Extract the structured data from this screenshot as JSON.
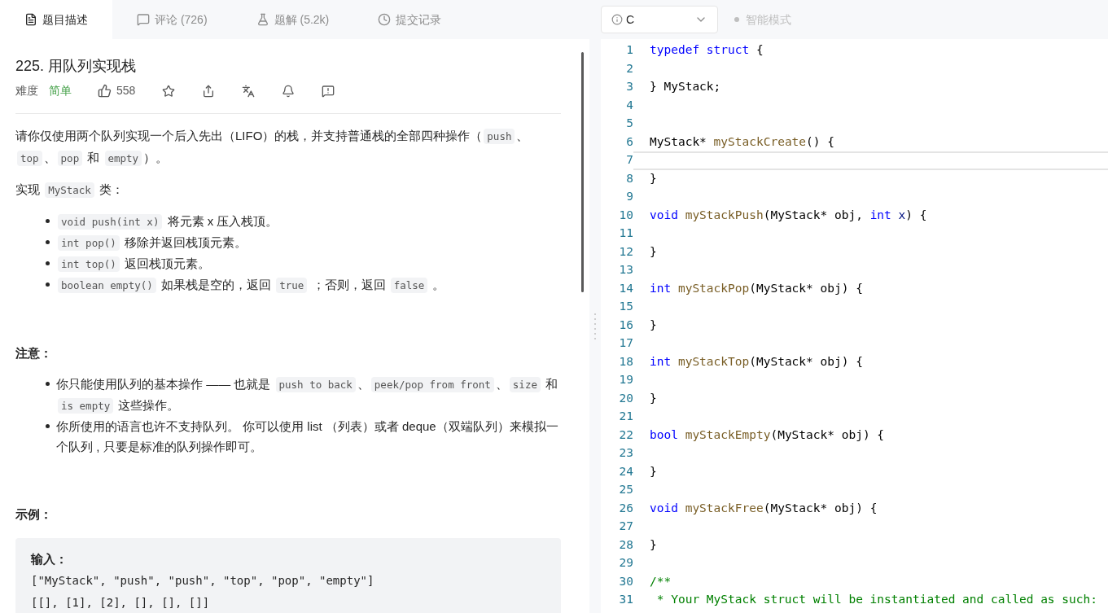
{
  "tabs": [
    {
      "label": "题目描述",
      "selected": true
    },
    {
      "label": "评论 (726)",
      "selected": false
    },
    {
      "label": "题解 (5.2k)",
      "selected": false
    },
    {
      "label": "提交记录",
      "selected": false
    }
  ],
  "language_select": {
    "value": "C"
  },
  "smart_mode": {
    "label": "智能模式",
    "on": false
  },
  "problem": {
    "title": "225. 用队列实现栈",
    "difficulty_label": "难度",
    "difficulty": "简单",
    "likes": "558"
  },
  "description": [
    {
      "kind": "paragraph",
      "segments": [
        {
          "kind": "text",
          "text": "请你仅使用两个队列实现一个后入先出（LIFO）的栈，并支持普通栈的全部四种操作（"
        },
        {
          "kind": "code",
          "text": "push"
        },
        {
          "kind": "text",
          "text": "、"
        },
        {
          "kind": "code",
          "text": "top"
        },
        {
          "kind": "text",
          "text": "、"
        },
        {
          "kind": "code",
          "text": "pop"
        },
        {
          "kind": "text",
          "text": " 和 "
        },
        {
          "kind": "code",
          "text": "empty"
        },
        {
          "kind": "text",
          "text": "）。"
        }
      ]
    },
    {
      "kind": "paragraph",
      "segments": [
        {
          "kind": "text",
          "text": "实现 "
        },
        {
          "kind": "code",
          "text": "MyStack"
        },
        {
          "kind": "text",
          "text": " 类："
        }
      ]
    },
    {
      "kind": "list",
      "items": [
        [
          {
            "kind": "code",
            "text": "void push(int x)"
          },
          {
            "kind": "text",
            "text": " 将元素 x 压入栈顶。"
          }
        ],
        [
          {
            "kind": "code",
            "text": "int pop()"
          },
          {
            "kind": "text",
            "text": " 移除并返回栈顶元素。"
          }
        ],
        [
          {
            "kind": "code",
            "text": "int top()"
          },
          {
            "kind": "text",
            "text": " 返回栈顶元素。"
          }
        ],
        [
          {
            "kind": "code",
            "text": "boolean empty()"
          },
          {
            "kind": "text",
            "text": " 如果栈是空的，返回 "
          },
          {
            "kind": "code",
            "text": "true"
          },
          {
            "kind": "text",
            "text": " ；否则，返回 "
          },
          {
            "kind": "code",
            "text": "false"
          },
          {
            "kind": "text",
            "text": " 。"
          }
        ]
      ]
    },
    {
      "kind": "heading",
      "text": "注意："
    },
    {
      "kind": "list",
      "items": [
        [
          {
            "kind": "text",
            "text": "你只能使用队列的基本操作 —— 也就是 "
          },
          {
            "kind": "code",
            "text": "push to back"
          },
          {
            "kind": "text",
            "text": "、"
          },
          {
            "kind": "code",
            "text": "peek/pop from front"
          },
          {
            "kind": "text",
            "text": "、"
          },
          {
            "kind": "code",
            "text": "size"
          },
          {
            "kind": "text",
            "text": " 和 "
          },
          {
            "kind": "code",
            "text": "is empty"
          },
          {
            "kind": "text",
            "text": " 这些操作。"
          }
        ],
        [
          {
            "kind": "text",
            "text": "你所使用的语言也许不支持队列。 你可以使用 list （列表）或者 deque（双端队列）来模拟一个队列 , 只要是标准的队列操作即可。"
          }
        ]
      ]
    },
    {
      "kind": "heading",
      "text": "示例："
    },
    {
      "kind": "example",
      "label": "输入：",
      "lines": [
        "[\"MyStack\", \"push\", \"push\", \"top\", \"pop\", \"empty\"]",
        "[[], [1], [2], [], [], []]"
      ]
    }
  ],
  "editor": {
    "lines": [
      {
        "number": "1",
        "current": false,
        "tokens": [
          {
            "kind": "keyword",
            "text": "typedef struct"
          },
          {
            "kind": "plain",
            "text": " {"
          }
        ]
      },
      {
        "number": "2",
        "current": false
      },
      {
        "number": "3",
        "current": false,
        "tokens": [
          {
            "kind": "plain",
            "text": "} MyStack;"
          }
        ]
      },
      {
        "number": "4",
        "current": false
      },
      {
        "number": "5",
        "current": false
      },
      {
        "number": "6",
        "current": false,
        "tokens": [
          {
            "kind": "plain",
            "text": "MyStack* "
          },
          {
            "kind": "func",
            "text": "myStackCreate"
          },
          {
            "kind": "plain",
            "text": "() {"
          }
        ]
      },
      {
        "number": "7",
        "current": true
      },
      {
        "number": "8",
        "current": false,
        "tokens": [
          {
            "kind": "plain",
            "text": "}"
          }
        ]
      },
      {
        "number": "9",
        "current": false
      },
      {
        "number": "10",
        "current": false,
        "tokens": [
          {
            "kind": "keyword",
            "text": "void"
          },
          {
            "kind": "func",
            "text": " myStackPush"
          },
          {
            "kind": "plain",
            "text": "(MyStack* obj, "
          },
          {
            "kind": "keyword",
            "text": "int"
          },
          {
            "kind": "param",
            "text": " x"
          },
          {
            "kind": "plain",
            "text": ") {"
          }
        ]
      },
      {
        "number": "11",
        "current": false
      },
      {
        "number": "12",
        "current": false,
        "tokens": [
          {
            "kind": "plain",
            "text": "}"
          }
        ]
      },
      {
        "number": "13",
        "current": false
      },
      {
        "number": "14",
        "current": false,
        "tokens": [
          {
            "kind": "keyword",
            "text": "int"
          },
          {
            "kind": "func",
            "text": " myStackPop"
          },
          {
            "kind": "plain",
            "text": "(MyStack* obj) {"
          }
        ]
      },
      {
        "number": "15",
        "current": false
      },
      {
        "number": "16",
        "current": false,
        "tokens": [
          {
            "kind": "plain",
            "text": "}"
          }
        ]
      },
      {
        "number": "17",
        "current": false
      },
      {
        "number": "18",
        "current": false,
        "tokens": [
          {
            "kind": "keyword",
            "text": "int"
          },
          {
            "kind": "func",
            "text": " myStackTop"
          },
          {
            "kind": "plain",
            "text": "(MyStack* obj) {"
          }
        ]
      },
      {
        "number": "19",
        "current": false
      },
      {
        "number": "20",
        "current": false,
        "tokens": [
          {
            "kind": "plain",
            "text": "}"
          }
        ]
      },
      {
        "number": "21",
        "current": false
      },
      {
        "number": "22",
        "current": false,
        "tokens": [
          {
            "kind": "keyword",
            "text": "bool"
          },
          {
            "kind": "func",
            "text": " myStackEmpty"
          },
          {
            "kind": "plain",
            "text": "(MyStack* obj) {"
          }
        ]
      },
      {
        "number": "23",
        "current": false
      },
      {
        "number": "24",
        "current": false,
        "tokens": [
          {
            "kind": "plain",
            "text": "}"
          }
        ]
      },
      {
        "number": "25",
        "current": false
      },
      {
        "number": "26",
        "current": false,
        "tokens": [
          {
            "kind": "keyword",
            "text": "void"
          },
          {
            "kind": "func",
            "text": " myStackFree"
          },
          {
            "kind": "plain",
            "text": "(MyStack* obj) {"
          }
        ]
      },
      {
        "number": "27",
        "current": false
      },
      {
        "number": "28",
        "current": false,
        "tokens": [
          {
            "kind": "plain",
            "text": "}"
          }
        ]
      },
      {
        "number": "29",
        "current": false
      },
      {
        "number": "30",
        "current": false,
        "tokens": [
          {
            "kind": "comment",
            "text": "/**"
          }
        ]
      },
      {
        "number": "31",
        "current": false,
        "tokens": [
          {
            "kind": "comment",
            "text": " * Your MyStack struct will be instantiated and called as such:"
          }
        ]
      }
    ]
  }
}
